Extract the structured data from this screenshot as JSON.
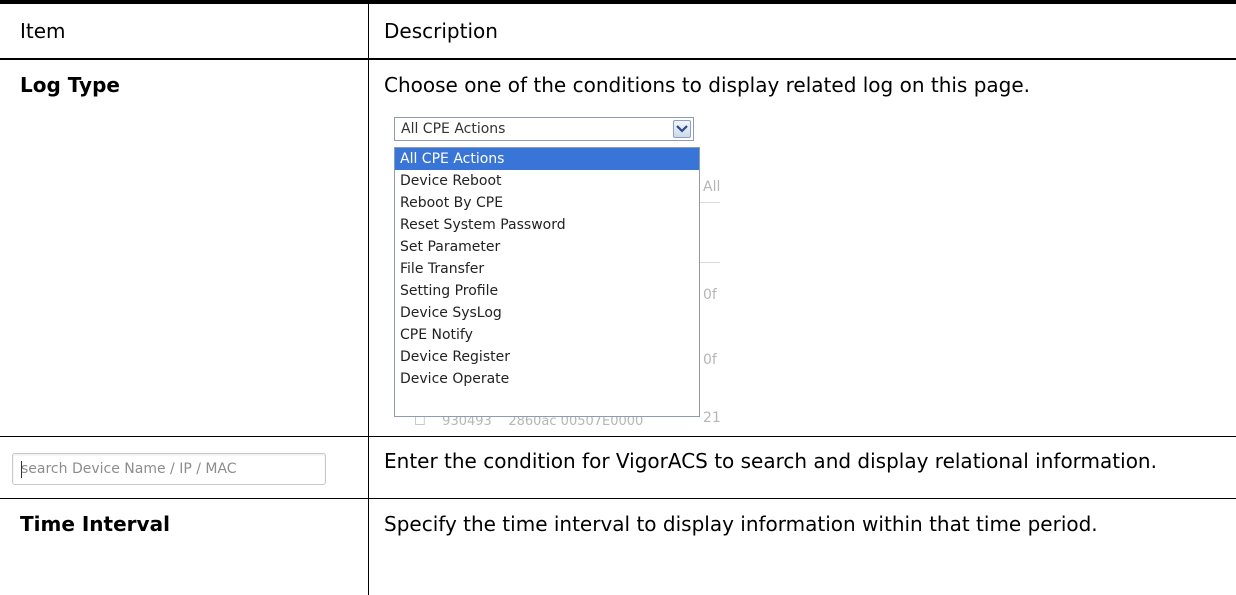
{
  "table": {
    "header": {
      "item": "Item",
      "description": "Description"
    },
    "rows": {
      "log_type": {
        "item": "Log Type",
        "description": "Choose one of the conditions to display related log on this page.",
        "dropdown": {
          "selected_value": "All CPE Actions",
          "options": [
            "All CPE Actions",
            "Device Reboot",
            "Reboot By CPE",
            "Reset System Password",
            "Set Parameter",
            "File Transfer",
            "Setting Profile",
            "Device SysLog",
            "CPE Notify",
            "Device Register",
            "Device Operate"
          ],
          "highlighted_option": "All CPE Actions",
          "highlight_color": "#3875d7"
        }
      },
      "search": {
        "placeholder": "search Device Name / IP / MAC",
        "description": "Enter the condition for VigorACS to search and display relational information."
      },
      "time_interval": {
        "item": "Time Interval",
        "description": "Specify the time interval to display information within that time period."
      }
    }
  }
}
